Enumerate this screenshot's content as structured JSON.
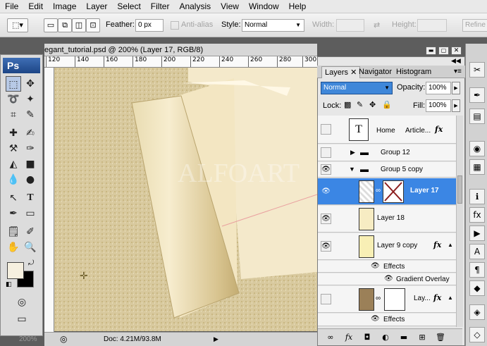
{
  "menu": [
    "File",
    "Edit",
    "Image",
    "Layer",
    "Select",
    "Filter",
    "Analysis",
    "View",
    "Window",
    "Help"
  ],
  "options": {
    "feather_label": "Feather:",
    "feather_value": "0 px",
    "antialias_label": "Anti-alias",
    "style_label": "Style:",
    "style_value": "Normal",
    "width_label": "Width:",
    "height_label": "Height:",
    "refine_label": "Refine"
  },
  "app_logo": "Ps",
  "document": {
    "title": "egant_tutorial.psd @ 200% (Layer 17, RGB/8)",
    "ruler_ticks": [
      "120",
      "140",
      "160",
      "180",
      "200",
      "220",
      "240",
      "260",
      "280",
      "300"
    ],
    "status": "Doc: 4.21M/93.8M",
    "zoom": "200%",
    "watermark": "ALFOART"
  },
  "panel": {
    "tabs": [
      "Layers",
      "Navigator",
      "Histogram"
    ],
    "blend_mode": "Normal",
    "opacity_label": "Opacity:",
    "opacity_value": "100%",
    "lock_label": "Lock:",
    "fill_label": "Fill:",
    "fill_value": "100%",
    "fx_label": "fx",
    "layers": [
      {
        "name": "Home",
        "extra": "Article...",
        "fx": "fx",
        "type": "text",
        "visible": false
      },
      {
        "name": "Group 12",
        "type": "group",
        "visible": false
      },
      {
        "name": "Group 5 copy",
        "type": "group-open",
        "visible": true
      },
      {
        "name": "Layer 17",
        "type": "masked",
        "visible": true,
        "selected": true
      },
      {
        "name": "Layer 18",
        "type": "layer",
        "visible": true
      },
      {
        "name": "Layer 9 copy",
        "type": "layer",
        "fx": "fx",
        "visible": true
      },
      {
        "name": "Effects",
        "type": "effects"
      },
      {
        "name": "Gradient Overlay",
        "type": "effect-item"
      },
      {
        "name": "Lay...",
        "type": "masked",
        "visible": false
      },
      {
        "name": "Effects",
        "type": "effects"
      }
    ]
  },
  "colors": {
    "accent": "#3b86e4",
    "canvas_bg": "#d6c69a",
    "paper": "#f3e6c2"
  }
}
